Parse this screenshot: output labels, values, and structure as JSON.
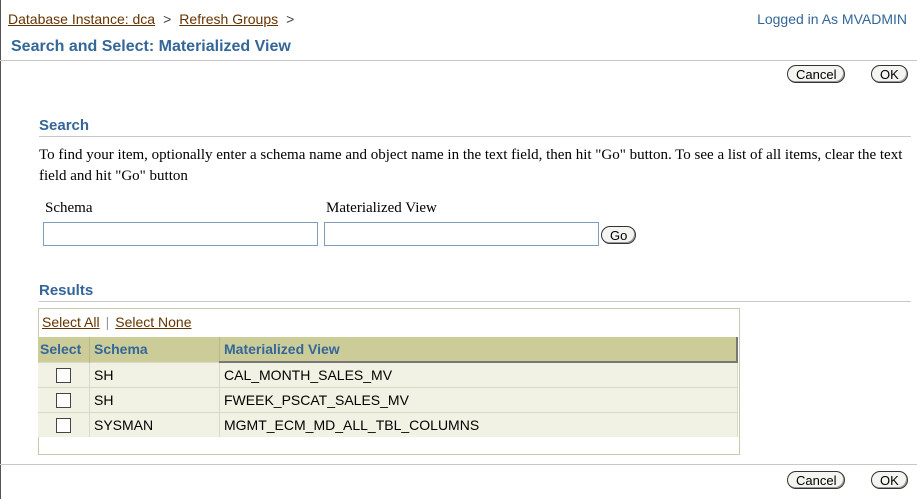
{
  "breadcrumb": {
    "items": [
      "Database Instance: dca",
      "Refresh Groups"
    ],
    "separator": ">"
  },
  "login": {
    "text": "Logged in As MVADMIN"
  },
  "page": {
    "title": "Search and Select: Materialized View"
  },
  "actions": {
    "cancel_label": "Cancel",
    "ok_label": "OK"
  },
  "search": {
    "heading": "Search",
    "help_text": "To find your item, optionally enter a schema name and object name in the text field, then hit \"Go\" button. To see a list of all items, clear the text field and hit \"Go\" button",
    "schema_label": "Schema",
    "schema_value": "",
    "mv_label": "Materialized View",
    "mv_value": "",
    "go_label": "Go"
  },
  "results": {
    "heading": "Results",
    "select_all": "Select All",
    "select_none": "Select None",
    "columns": [
      "Select",
      "Schema",
      "Materialized View"
    ],
    "rows": [
      {
        "schema": "SH",
        "mview": "CAL_MONTH_SALES_MV",
        "selected": false
      },
      {
        "schema": "SH",
        "mview": "FWEEK_PSCAT_SALES_MV",
        "selected": false
      },
      {
        "schema": "SYSMAN",
        "mview": "MGMT_ECM_MD_ALL_TBL_COLUMNS",
        "selected": false
      }
    ]
  },
  "colors": {
    "heading": "#336699",
    "link": "#663300",
    "table_header": "#cccc99",
    "table_row": "#f2f2e4"
  }
}
